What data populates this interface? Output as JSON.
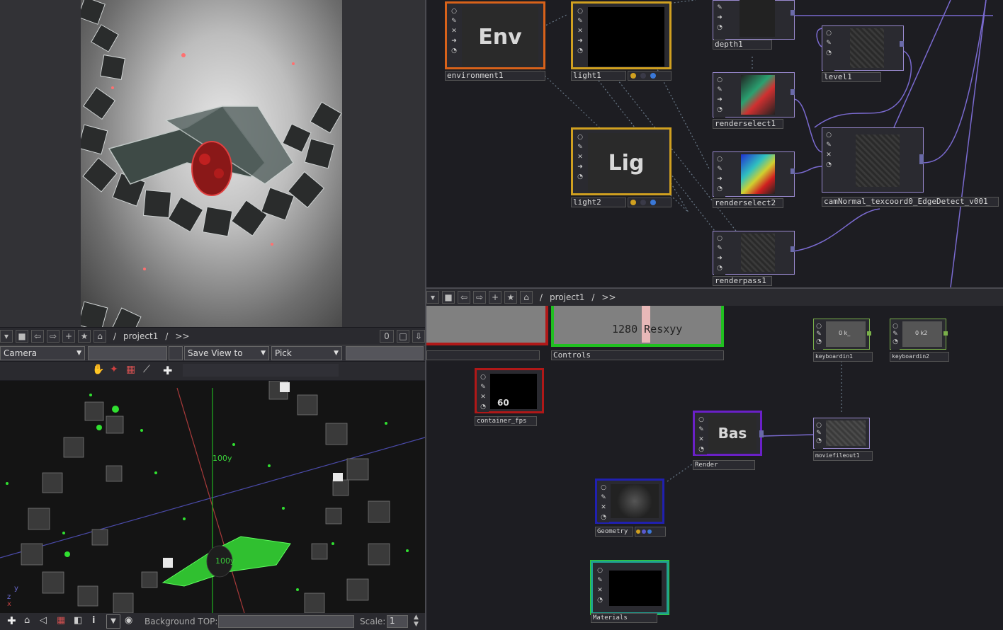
{
  "top_pathbar": {
    "path_root": "/",
    "path_project": "project1",
    "path_sep": "/",
    "path_more": ">>",
    "counter": "0"
  },
  "viewer": {
    "camera_select": "Camera",
    "save_view_select": "Save View to",
    "pick_select": "Pick",
    "axis_label_1": "100y",
    "axis_label_2": "100y",
    "background_label": "Background TOP:",
    "scale_label": "Scale:",
    "scale_value": "1",
    "axis_gizmo_x": "x",
    "axis_gizmo_y": "y",
    "axis_gizmo_z": "z"
  },
  "bottom_pathbar": {
    "path_root": "/",
    "path_project": "project1",
    "path_sep": "/",
    "path_more": ">>"
  },
  "nodes_top": {
    "environment": {
      "label": "environment1",
      "thumb_text": "Env"
    },
    "light1": {
      "label": "light1"
    },
    "light2": {
      "label": "light2",
      "thumb_text": "Lig"
    },
    "depth1": {
      "label": "depth1"
    },
    "renderselect1": {
      "label": "renderselect1"
    },
    "renderselect2": {
      "label": "renderselect2"
    },
    "renderpass1": {
      "label": "renderpass1"
    },
    "level1": {
      "label": "level1"
    },
    "camnormal": {
      "label": "camNormal_texcoord0_EdgeDetect_v001"
    }
  },
  "nodes_bottom": {
    "controls": {
      "label": "Controls",
      "thumb_text": "1280 Resxyy"
    },
    "container_fps": {
      "label": "container_fps",
      "thumb_text": "60"
    },
    "keyboardin1": {
      "label": "keyboardin1",
      "thumb_text": "0 k_"
    },
    "keyboardin2": {
      "label": "keyboardin2",
      "thumb_text": "0 k2"
    },
    "render": {
      "label": "Render",
      "thumb_text": "Bas"
    },
    "moviefileout1": {
      "label": "moviefileout1"
    },
    "geometry": {
      "label": "Geometry"
    },
    "materials": {
      "label": "Materials"
    }
  },
  "colors": {
    "comp_orange": "#d8621a",
    "light_gold": "#d0a020",
    "top_purple": "#9a8ad0",
    "chop_green": "#7ab04a",
    "geo_blue": "#2020b0",
    "mat_teal": "#20a090",
    "render_violet": "#6a20c8",
    "controls_green": "#20c020",
    "fps_red": "#b01818",
    "wire": "#7a6ad0"
  }
}
